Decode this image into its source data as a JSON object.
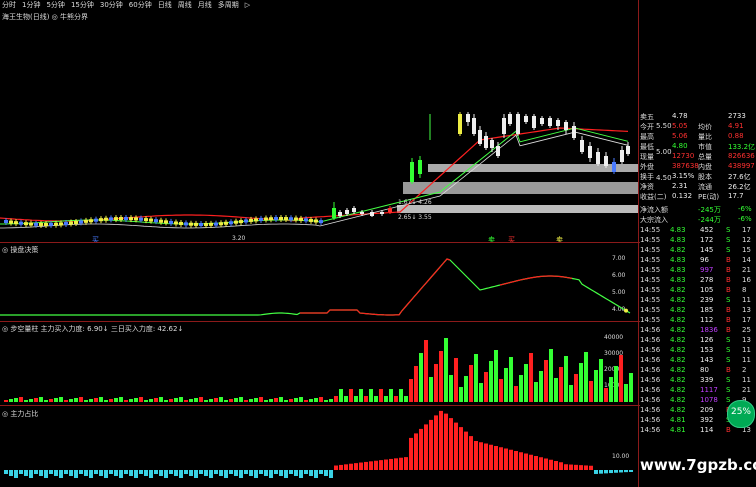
{
  "toolbar": {
    "items": [
      "分时",
      "1分钟",
      "5分钟",
      "15分钟",
      "30分钟",
      "60分钟",
      "日线",
      "周线",
      "月线",
      "多周期",
      "▷"
    ]
  },
  "chart": {
    "stock_label": "海王生物(日线) ◎ 牛熊分界",
    "range_label": "1.67↓ 4.26",
    "low_label": "2.65↓ 3.55",
    "small_label": "3.20",
    "price_axis": [
      "5.50",
      "5.00",
      "4.50"
    ],
    "markers": [
      "买",
      "卖",
      "买",
      "卖"
    ]
  },
  "panes": {
    "main_label": "◎ 操盘决策",
    "main_axis": [
      "7.00",
      "6.00",
      "5.00",
      "4.00"
    ],
    "volume_label": "◎ 步空量柱  主力买入力度: 6.90↓  三日买入力度: 42.62↓",
    "volume_axis": [
      "40000",
      "30000",
      "20000",
      "10000"
    ],
    "bottom_label": "◎ 主力占比",
    "bottom_axis": [
      "10.00"
    ]
  },
  "quote": {
    "rows": [
      {
        "label": "卖五",
        "value": "4.78",
        "extra": "2733",
        "color": "#eee"
      },
      {
        "label": "今开",
        "value": "5.05",
        "extra_label": "均价",
        "extra": "4.91",
        "color": "#ff3030"
      },
      {
        "label": "最高",
        "value": "5.06",
        "extra_label": "量比",
        "extra": "0.88",
        "color": "#ff3030"
      },
      {
        "label": "最低",
        "value": "4.80",
        "extra_label": "市值",
        "extra": "133.2亿",
        "color": "#3f3"
      },
      {
        "label": "现量",
        "value": "12730",
        "extra_label": "总量",
        "extra": "826636",
        "color": "#ff3030"
      },
      {
        "label": "外盘",
        "value": "387638",
        "extra_label": "内盘",
        "extra": "438997",
        "color": "#ff3030"
      },
      {
        "label": "换手",
        "value": "3.15%",
        "extra_label": "股本",
        "extra": "27.6亿",
        "color": "#eee"
      },
      {
        "label": "净资",
        "value": "2.31",
        "extra_label": "流通",
        "extra": "26.2亿",
        "color": "#eee"
      },
      {
        "label": "收益(二)",
        "value": "0.132",
        "extra_label": "PE(动)",
        "extra": "17.7",
        "color": "#eee"
      }
    ]
  },
  "flow": {
    "net_label": "净流入额",
    "net_value": "-245万",
    "net_pct": "-6%",
    "big_label": "大宗流入",
    "big_value": "-244万",
    "big_pct": "-6%"
  },
  "trades": [
    {
      "time": "14:55",
      "price": "4.83",
      "vol": "452",
      "side": "S",
      "num": "17"
    },
    {
      "time": "14:55",
      "price": "4.83",
      "vol": "172",
      "side": "S",
      "num": "12"
    },
    {
      "time": "14:55",
      "price": "4.82",
      "vol": "145",
      "side": "S",
      "num": "15"
    },
    {
      "time": "14:55",
      "price": "4.83",
      "vol": "96",
      "side": "B",
      "num": "14"
    },
    {
      "time": "14:55",
      "price": "4.83",
      "vol": "997",
      "side": "B",
      "num": "21"
    },
    {
      "time": "14:55",
      "price": "4.83",
      "vol": "278",
      "side": "B",
      "num": "16"
    },
    {
      "time": "14:55",
      "price": "4.82",
      "vol": "105",
      "side": "B",
      "num": "8"
    },
    {
      "time": "14:55",
      "price": "4.82",
      "vol": "239",
      "side": "S",
      "num": "11"
    },
    {
      "time": "14:55",
      "price": "4.82",
      "vol": "185",
      "side": "B",
      "num": "13"
    },
    {
      "time": "14:55",
      "price": "4.82",
      "vol": "112",
      "side": "B",
      "num": "17"
    },
    {
      "time": "14:56",
      "price": "4.82",
      "vol": "1836",
      "side": "B",
      "num": "25"
    },
    {
      "time": "14:56",
      "price": "4.82",
      "vol": "126",
      "side": "S",
      "num": "13"
    },
    {
      "time": "14:56",
      "price": "4.82",
      "vol": "153",
      "side": "S",
      "num": "11"
    },
    {
      "time": "14:56",
      "price": "4.82",
      "vol": "143",
      "side": "S",
      "num": "11"
    },
    {
      "time": "14:56",
      "price": "4.82",
      "vol": "80",
      "side": "B",
      "num": "2"
    },
    {
      "time": "14:56",
      "price": "4.82",
      "vol": "339",
      "side": "S",
      "num": "11"
    },
    {
      "time": "14:56",
      "price": "4.82",
      "vol": "1117",
      "side": "S",
      "num": "21"
    },
    {
      "time": "14:56",
      "price": "4.82",
      "vol": "1078",
      "side": "S",
      "num": "9"
    },
    {
      "time": "14:56",
      "price": "4.82",
      "vol": "209",
      "side": "B",
      "num": "15"
    },
    {
      "time": "14:56",
      "price": "4.81",
      "vol": "392",
      "side": "S",
      "num": "17"
    },
    {
      "time": "14:56",
      "price": "4.81",
      "vol": "114",
      "side": "B",
      "num": "13"
    }
  ],
  "badge": {
    "text": "25%"
  },
  "watermark": "www.7gpzb.com",
  "colors": {
    "up": "#ff3030",
    "down": "#33ff33",
    "grid": "#8b1a1a",
    "ma": "#ff2020",
    "flat": "#3ad3e6"
  }
}
